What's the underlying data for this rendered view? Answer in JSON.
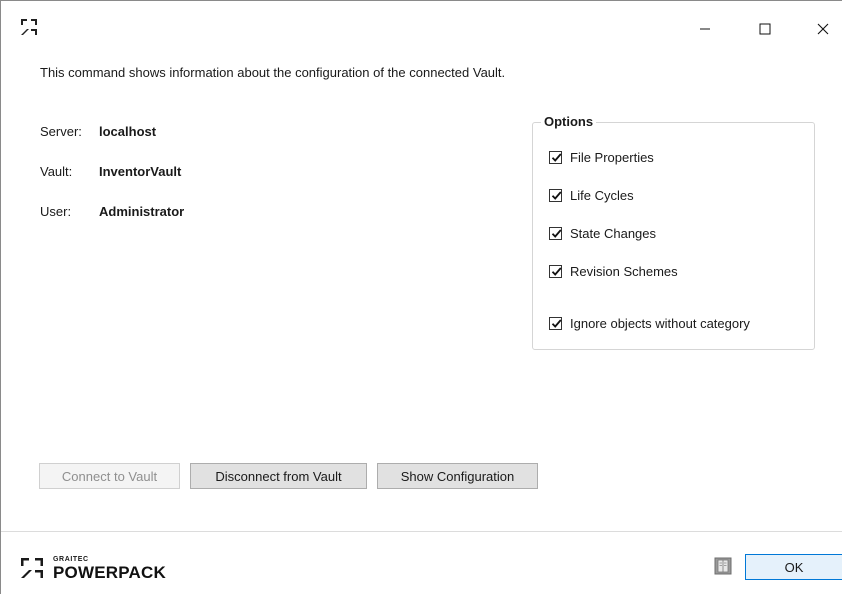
{
  "window": {
    "controls": {
      "minimize": "minimize-icon",
      "maximize": "maximize-icon",
      "close": "close-icon"
    }
  },
  "description": "This command shows information about the configuration of the connected Vault.",
  "info": {
    "server_label": "Server:",
    "server_value": "localhost",
    "vault_label": "Vault:",
    "vault_value": "InventorVault",
    "user_label": "User:",
    "user_value": "Administrator"
  },
  "options": {
    "title": "Options",
    "items": [
      {
        "label": "File Properties",
        "checked": true
      },
      {
        "label": "Life Cycles",
        "checked": true
      },
      {
        "label": "State Changes",
        "checked": true
      },
      {
        "label": "Revision Schemes",
        "checked": true
      },
      {
        "label": "Ignore objects without category",
        "checked": true
      }
    ]
  },
  "buttons": {
    "connect": "Connect to Vault",
    "disconnect": "Disconnect from Vault",
    "show_config": "Show Configuration",
    "ok": "OK"
  },
  "footer": {
    "logo_small": "GRAITEC",
    "logo_big": "POWERPACK",
    "help_icon": "help-book-icon"
  },
  "colors": {
    "accent": "#0078d7",
    "ok_bg": "#e5f1fb"
  }
}
